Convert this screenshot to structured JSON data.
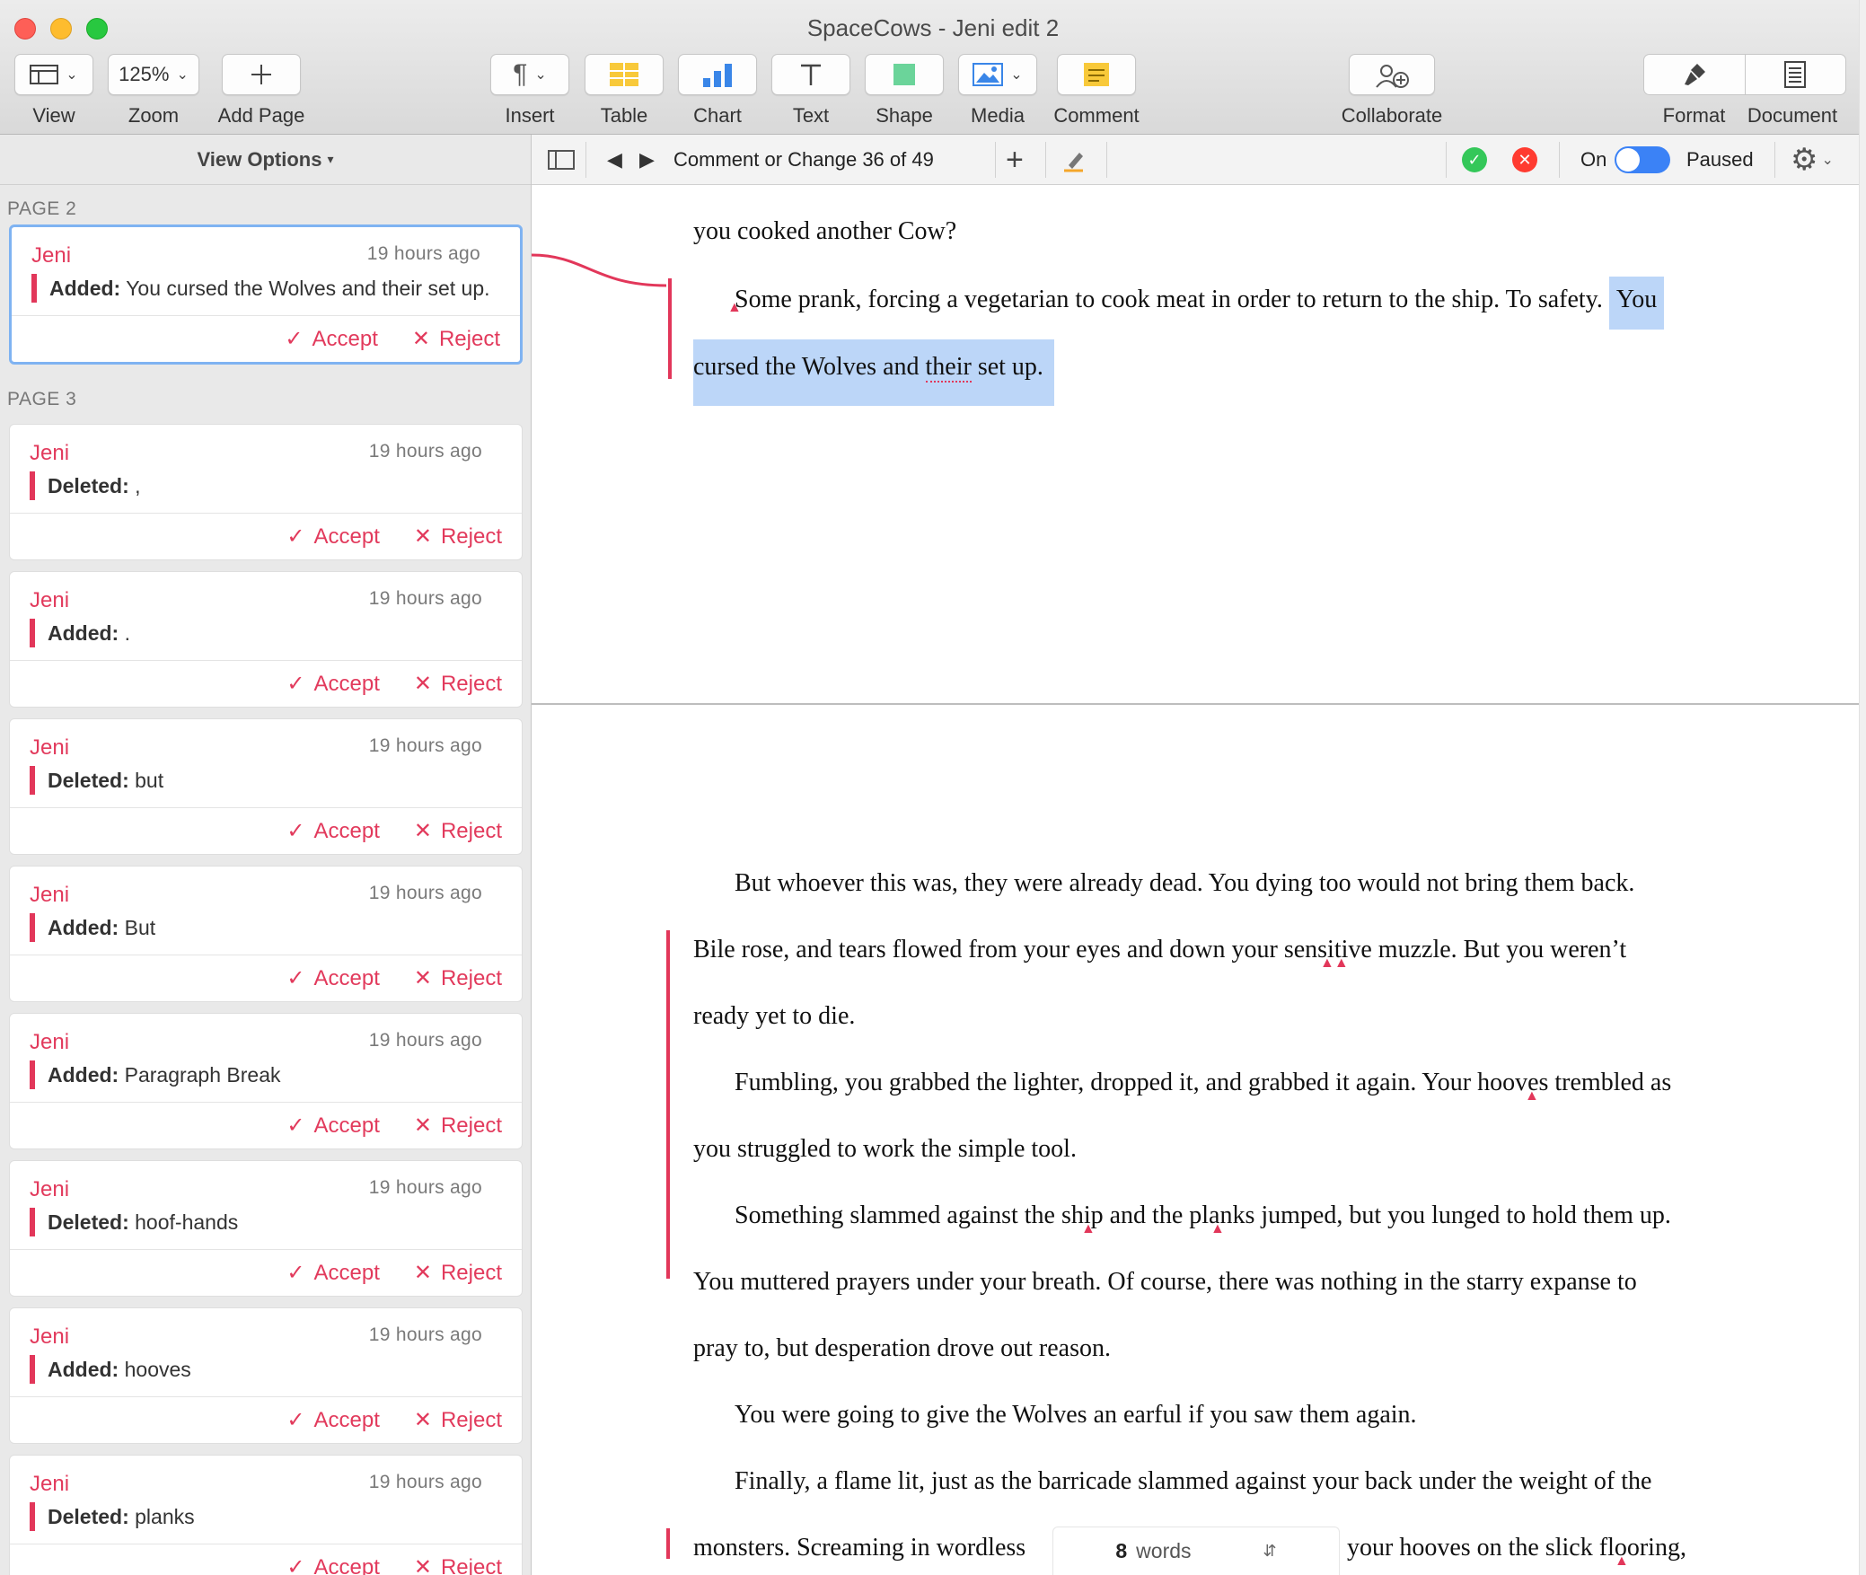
{
  "window": {
    "title": "SpaceCows - Jeni edit 2"
  },
  "toolbar": {
    "view": "View",
    "zoom_value": "125%",
    "zoom": "Zoom",
    "add_page": "Add Page",
    "insert": "Insert",
    "table": "Table",
    "chart": "Chart",
    "text": "Text",
    "shape": "Shape",
    "media": "Media",
    "comment": "Comment",
    "collaborate": "Collaborate",
    "format": "Format",
    "document": "Document"
  },
  "sidebar": {
    "view_options": "View Options",
    "page2": "PAGE 2",
    "page3": "PAGE 3",
    "accept": "Accept",
    "reject": "Reject",
    "cards": [
      {
        "author": "Jeni",
        "time": "19 hours ago",
        "kind": "Added:",
        "text": "You cursed the Wolves and their set up."
      },
      {
        "author": "Jeni",
        "time": "19 hours ago",
        "kind": "Deleted:",
        "text": ","
      },
      {
        "author": "Jeni",
        "time": "19 hours ago",
        "kind": "Added:",
        "text": "."
      },
      {
        "author": "Jeni",
        "time": "19 hours ago",
        "kind": "Deleted:",
        "text": "but"
      },
      {
        "author": "Jeni",
        "time": "19 hours ago",
        "kind": "Added:",
        "text": "But"
      },
      {
        "author": "Jeni",
        "time": "19 hours ago",
        "kind": "Added:",
        "text": "Paragraph Break"
      },
      {
        "author": "Jeni",
        "time": "19 hours ago",
        "kind": "Deleted:",
        "text": "hoof-hands"
      },
      {
        "author": "Jeni",
        "time": "19 hours ago",
        "kind": "Added:",
        "text": "hooves"
      },
      {
        "author": "Jeni",
        "time": "19 hours ago",
        "kind": "Deleted:",
        "text": "planks"
      }
    ]
  },
  "review": {
    "counter": "Comment or Change 36 of 49",
    "tracking_label": "On",
    "tracking_on": true,
    "paused": "Paused",
    "accept_color": "#34c759",
    "reject_color": "#ff3b30"
  },
  "doc": {
    "p2_line1": "you cooked another Cow?",
    "p2_line2a": "Some prank, forcing a vegetarian to cook meat in order to return to the ship. To safety. ",
    "p2_line2b": "You",
    "p2_line3a": "cursed the Wolves and ",
    "p2_line3b": "their",
    "p2_line3c": " set up.",
    "l1": "But whoever this was, they were already dead. You dying too would not bring them back.",
    "l2": "Bile rose, and tears flowed from your eyes and down your sensitive muzzle. But you weren’t",
    "l3": "ready yet to die.",
    "l4": "Fumbling, you grabbed the lighter, dropped it, and grabbed it again. Your hooves trembled as",
    "l5": "you struggled to work the simple tool.",
    "l6": "Something slammed against the ship and the planks jumped, but you lunged to hold them up.",
    "l7": "You muttered prayers under your breath. Of course, there was nothing in the starry expanse to",
    "l8": "pray to, but desperation drove out reason.",
    "l9": "You were going to give the Wolves an earful if you saw them again.",
    "l10": "Finally, a flame lit, just as the barricade slammed against your back under the weight of the",
    "l11a": "monsters. Screaming in wordless",
    "l11b": "your hooves on the slick flooring,"
  },
  "word_count": {
    "number": "8",
    "label": "words"
  },
  "colors": {
    "accent_red": "#e23a5c",
    "selection_blue": "#bcd6f8",
    "toggle_blue": "#3b82f6"
  }
}
